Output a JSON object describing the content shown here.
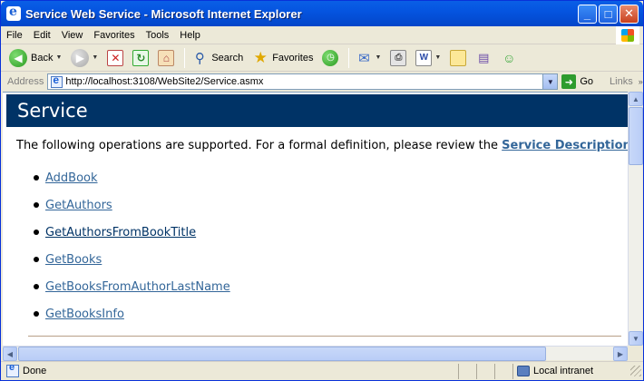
{
  "window": {
    "title": "Service Web Service - Microsoft Internet Explorer"
  },
  "menu": {
    "items": [
      "File",
      "Edit",
      "View",
      "Favorites",
      "Tools",
      "Help"
    ]
  },
  "toolbar": {
    "back_label": "Back",
    "search_label": "Search",
    "favorites_label": "Favorites"
  },
  "address": {
    "label": "Address",
    "url": "http://localhost:3108/WebSite2/Service.asmx",
    "go_label": "Go",
    "links_label": "Links"
  },
  "page": {
    "heading": "Service",
    "intro_text": "The following operations are supported. For a formal definition, please review the ",
    "intro_link": "Service Description",
    "intro_end": ".",
    "operations": [
      {
        "name": "AddBook",
        "style": "normal"
      },
      {
        "name": "GetAuthors",
        "style": "normal"
      },
      {
        "name": "GetAuthorsFromBookTitle",
        "style": "dark"
      },
      {
        "name": "GetBooks",
        "style": "normal"
      },
      {
        "name": "GetBooksFromAuthorLastName",
        "style": "normal"
      },
      {
        "name": "GetBooksInfo",
        "style": "normal"
      }
    ]
  },
  "status": {
    "text": "Done",
    "zone": "Local intranet"
  },
  "colors": {
    "heading_bg": "#003366",
    "link": "#336699",
    "link_dark": "#003366"
  },
  "icons": [
    "ie-icon",
    "minimize-icon",
    "maximize-icon",
    "close-icon",
    "windows-logo-icon",
    "back-icon",
    "forward-icon",
    "stop-icon",
    "refresh-icon",
    "home-icon",
    "search-icon",
    "favorites-icon",
    "history-icon",
    "mail-icon",
    "print-icon",
    "edit-word-icon",
    "folder-icon",
    "research-icon",
    "messenger-icon",
    "go-icon",
    "intranet-icon"
  ]
}
